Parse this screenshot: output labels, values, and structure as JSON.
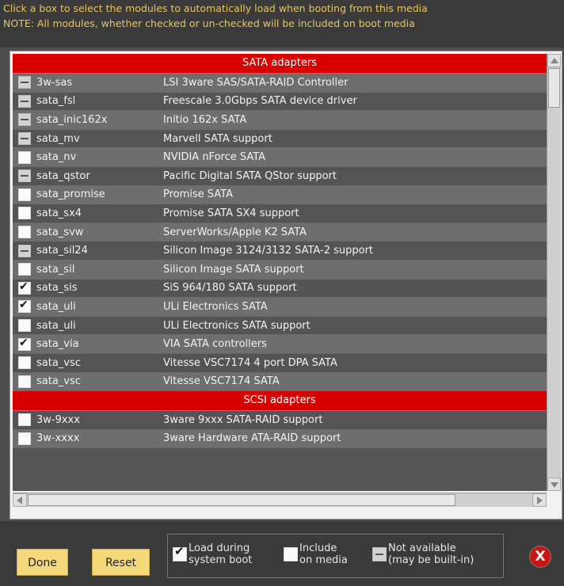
{
  "header": {
    "line1": "Click a box to select the modules to automatically load when booting from this media",
    "line2": "NOTE: All modules, whether checked or un-checked will be included on boot media"
  },
  "sections": [
    {
      "title": "SATA adapters",
      "rows": [
        {
          "name": "3w-sas",
          "desc": "LSI 3ware SAS/SATA-RAID Controller",
          "state": "na"
        },
        {
          "name": "sata_fsl",
          "desc": "Freescale 3.0Gbps SATA device driver",
          "state": "na"
        },
        {
          "name": "sata_inic162x",
          "desc": "Initio 162x SATA",
          "state": "na"
        },
        {
          "name": "sata_mv",
          "desc": "Marvell SATA support",
          "state": "na"
        },
        {
          "name": "sata_nv",
          "desc": "NVIDIA nForce SATA",
          "state": "unchecked"
        },
        {
          "name": "sata_qstor",
          "desc": "Pacific Digital SATA QStor support",
          "state": "na"
        },
        {
          "name": "sata_promise",
          "desc": "Promise SATA",
          "state": "unchecked"
        },
        {
          "name": "sata_sx4",
          "desc": "Promise SATA SX4 support",
          "state": "unchecked"
        },
        {
          "name": "sata_svw",
          "desc": "ServerWorks/Apple K2 SATA",
          "state": "unchecked"
        },
        {
          "name": "sata_sil24",
          "desc": "Silicon Image 3124/3132 SATA-2 support",
          "state": "na"
        },
        {
          "name": "sata_sil",
          "desc": "Silicon Image SATA support",
          "state": "unchecked"
        },
        {
          "name": "sata_sis",
          "desc": "SiS 964/180 SATA support",
          "state": "checked"
        },
        {
          "name": "sata_uli",
          "desc": "ULi Electronics SATA",
          "state": "checked"
        },
        {
          "name": "sata_uli",
          "desc": "ULi Electronics SATA support",
          "state": "unchecked"
        },
        {
          "name": "sata_via",
          "desc": "VIA SATA controllers",
          "state": "checked"
        },
        {
          "name": "sata_vsc",
          "desc": "Vitesse VSC7174 4 port DPA SATA",
          "state": "unchecked"
        },
        {
          "name": "sata_vsc",
          "desc": "Vitesse VSC7174 SATA",
          "state": "unchecked"
        }
      ]
    },
    {
      "title": "SCSI adapters",
      "rows": [
        {
          "name": "3w-9xxx",
          "desc": "3ware 9xxx SATA-RAID support",
          "state": "unchecked"
        },
        {
          "name": "3w-xxxx",
          "desc": "3ware Hardware ATA-RAID support",
          "state": "unchecked"
        }
      ]
    }
  ],
  "footer": {
    "done_label": "Done",
    "reset_label": "Reset",
    "legend_checked_line1": "Load during",
    "legend_checked_line2": "system boot",
    "legend_unchecked_line1": "Include",
    "legend_unchecked_line2": "on media",
    "legend_na_line1": "Not available",
    "legend_na_line2": "(may be built-in)",
    "close_glyph": "X"
  },
  "colors": {
    "header_text": "#e8c660",
    "section_header_bg": "#d90000",
    "button_bg": "#f3d97a",
    "close_bg": "#c91414"
  }
}
